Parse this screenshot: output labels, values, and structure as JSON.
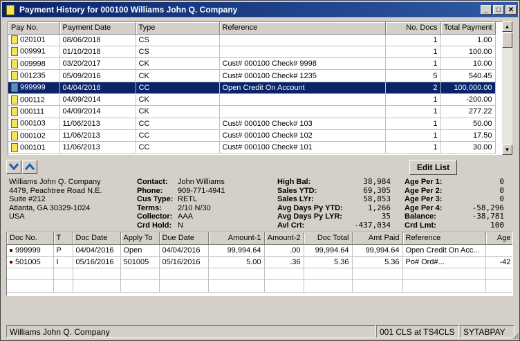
{
  "window": {
    "title": "Payment History for 000100 Williams John Q. Company"
  },
  "payments": {
    "columns": [
      "Pay No.",
      "Payment Date",
      "Type",
      "Reference",
      "No. Docs",
      "Total Payment"
    ],
    "rows": [
      [
        "020101",
        "08/06/2018",
        "CS",
        "",
        "1",
        "1.00"
      ],
      [
        "009991",
        "01/10/2018",
        "CS",
        "",
        "1",
        "100.00"
      ],
      [
        "009998",
        "03/20/2017",
        "CK",
        "Cust# 000100  Check#   9998",
        "1",
        "10.00"
      ],
      [
        "001235",
        "05/09/2016",
        "CK",
        "Cust# 000100  Check#   1235",
        "5",
        "540.45"
      ],
      [
        "999999",
        "04/04/2016",
        "CC",
        "Open Credit On Account",
        "2",
        "100,000.00"
      ],
      [
        "000112",
        "04/09/2014",
        "CK",
        "",
        "1",
        "-200.00"
      ],
      [
        "000111",
        "04/09/2014",
        "CK",
        "",
        "1",
        "277.22"
      ],
      [
        "000103",
        "11/06/2013",
        "CC",
        "Cust# 000100  Check#    103",
        "1",
        "50.00"
      ],
      [
        "000102",
        "11/06/2013",
        "CC",
        "Cust# 000100  Check#    102",
        "1",
        "17.50"
      ],
      [
        "000101",
        "11/06/2013",
        "CC",
        "Cust# 000100  Check#    101",
        "1",
        "30.00"
      ]
    ]
  },
  "customer": {
    "name": "Williams John Q. Company",
    "addr1": "4479, Peachtree Road N.E.",
    "addr2": "Suite #212",
    "addr3": "Atlanta, GA 30329-1024",
    "country": "USA"
  },
  "contact": {
    "labels": [
      "Contact:",
      "Phone:",
      "Cus Type:",
      "Terms:",
      "Collector:",
      "Crd Hold:"
    ],
    "values": [
      "John Williams",
      "909-771-4941",
      "RETL",
      "2/10 N/30",
      "AAA",
      "N"
    ]
  },
  "balances": {
    "labels": [
      "High Bal:",
      "Sales YTD:",
      "Sales LYr:",
      "Avg Days Py YTD:",
      "Avg Days Py LYR:",
      "Avl Crt:"
    ],
    "values": [
      "38,984",
      "69,305",
      "58,853",
      "1,266",
      "35",
      "-437,034"
    ]
  },
  "aging": {
    "labels": [
      "Age Per 1:",
      "Age Per 2:",
      "Age Per 3:",
      "Age Per 4:",
      "Balance:",
      "Crd Lmt:"
    ],
    "values": [
      "0",
      "0",
      "0",
      "-58,296",
      "-38,781",
      "100"
    ]
  },
  "buttons": {
    "edit_list": "Edit List"
  },
  "docs": {
    "columns": [
      "Doc No.",
      "T",
      "Doc Date",
      "Apply To",
      "Due Date",
      "Amount-1",
      "Amount-2",
      "Doc Total",
      "Amt Paid",
      "Reference",
      "Age"
    ],
    "rows": [
      [
        "999999",
        "P",
        "04/04/2016",
        "Open",
        "04/04/2016",
        "99,994.64",
        ".00",
        "99,994.64",
        "99,994.64",
        "Open Credit On Acc...",
        ""
      ],
      [
        "501005",
        "I",
        "05/16/2016",
        "501005",
        "05/16/2016",
        "5.00",
        ".36",
        "5.36",
        "5.36",
        "Po#              Ord#...",
        "-42"
      ]
    ]
  },
  "status": {
    "customer": "Williams John Q. Company",
    "session": "001 CLS at TS4CLS",
    "program": "SYTABPAY"
  },
  "colors": {
    "title_bar": "#0a246a",
    "selection": "#0a246a",
    "window": "#d4d0c8"
  }
}
